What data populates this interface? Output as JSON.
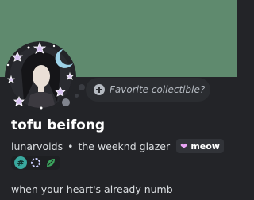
{
  "profile": {
    "display_name": "tofu beifong",
    "username": "lunarvoids",
    "separator": "•",
    "tagline": "the weeknd glazer",
    "pronoun_badge": {
      "icon": "heart-icon",
      "text": "meow"
    },
    "collectible_placeholder": "Favorite collectible?",
    "bio": "when your heart's already numb",
    "status": "offline",
    "badges": [
      {
        "name": "hypesquad-badge",
        "symbol": "#"
      },
      {
        "name": "active-developer-badge",
        "symbol": "✿"
      },
      {
        "name": "quest-badge",
        "symbol": "leaf"
      }
    ]
  },
  "colors": {
    "banner": "#5f8a6e",
    "card_bg": "#232428",
    "pronoun_heart": "#e8a3f4",
    "badge_green": "#3aa99f"
  }
}
